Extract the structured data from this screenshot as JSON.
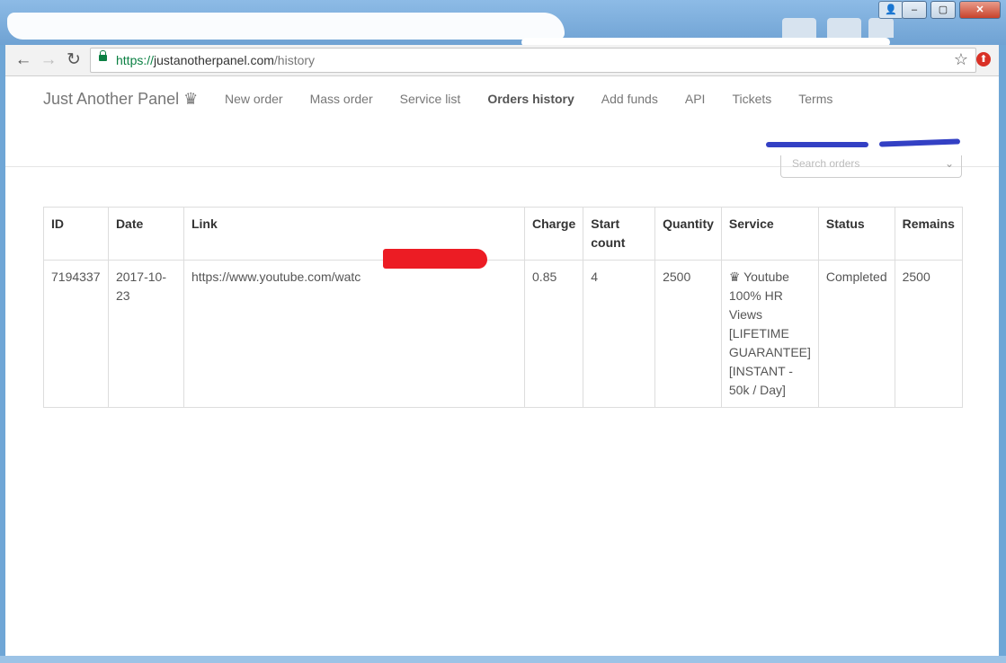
{
  "browser": {
    "url_scheme": "https://",
    "url_host": "justanotherpanel.com",
    "url_path": "/history",
    "back_icon": "arrow-left-icon",
    "forward_icon": "arrow-right-icon",
    "reload_icon": "reload-icon",
    "star_icon": "star-icon",
    "window_buttons": [
      "–",
      "▢",
      "✕"
    ]
  },
  "navbar": {
    "brand": "Just Another Panel ♛",
    "items": [
      {
        "label": "New order",
        "active": false
      },
      {
        "label": "Mass order",
        "active": false
      },
      {
        "label": "Service list",
        "active": false
      },
      {
        "label": "Orders history",
        "active": true
      },
      {
        "label": "Add funds",
        "active": false
      },
      {
        "label": "API",
        "active": false
      },
      {
        "label": "Tickets",
        "active": false
      },
      {
        "label": "Terms",
        "active": false
      }
    ]
  },
  "search": {
    "placeholder": "Search orders"
  },
  "orders": {
    "columns": [
      "ID",
      "Date",
      "Link",
      "Charge",
      "Start count",
      "Quantity",
      "Service",
      "Status",
      "Remains"
    ],
    "rows": [
      {
        "id": "7194337",
        "date": "2017-10-23",
        "link": "https://www.youtube.com/watc",
        "charge": "0.85",
        "start_count": "4",
        "quantity": "2500",
        "service": "♛ Youtube 100% HR Views [LIFETIME GUARANTEE] [INSTANT - 50k / Day]",
        "status": "Completed",
        "remains": "2500"
      }
    ]
  },
  "colors": {
    "accent_secure": "#0b8043",
    "redaction_red": "#ec1c24",
    "redaction_blue": "#3340c4"
  }
}
